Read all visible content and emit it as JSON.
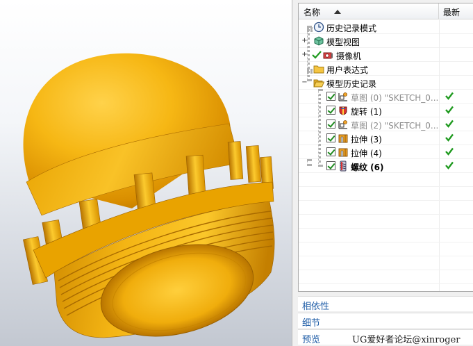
{
  "navigator": {
    "header": {
      "name_col": "名称",
      "latest_col": "最新"
    },
    "nodes": [
      {
        "label": "历史记录模式",
        "icon": "clock-icon"
      },
      {
        "label": "模型视图",
        "icon": "cube-views-icon"
      },
      {
        "label": "摄像机",
        "icon": "camera-icon"
      },
      {
        "label": "用户表达式",
        "icon": "folder-icon"
      },
      {
        "label": "模型历史记录",
        "icon": "folder-open-icon"
      }
    ],
    "features": [
      {
        "label": "草图 (0) \"SKETCH_0...",
        "icon": "sketch-icon",
        "style": "dim"
      },
      {
        "label": "旋转 (1)",
        "icon": "revolve-icon",
        "style": "normal"
      },
      {
        "label": "草图 (2) \"SKETCH_0...",
        "icon": "sketch-icon",
        "style": "dim"
      },
      {
        "label": "拉伸 (3)",
        "icon": "extrude-icon",
        "style": "normal"
      },
      {
        "label": "拉伸 (4)",
        "icon": "extrude-icon",
        "style": "normal"
      },
      {
        "label": "螺纹 (6)",
        "icon": "thread-icon",
        "style": "bold"
      }
    ],
    "sections": {
      "dependencies": "相依性",
      "details": "细节",
      "preview": "预览"
    }
  },
  "watermark": "UG爱好者论坛@xinroger",
  "colors": {
    "part_yellow": "#f2b312",
    "part_shadow": "#b87400",
    "check_green": "#1f9a1f",
    "link_blue": "#1c5ba6"
  }
}
